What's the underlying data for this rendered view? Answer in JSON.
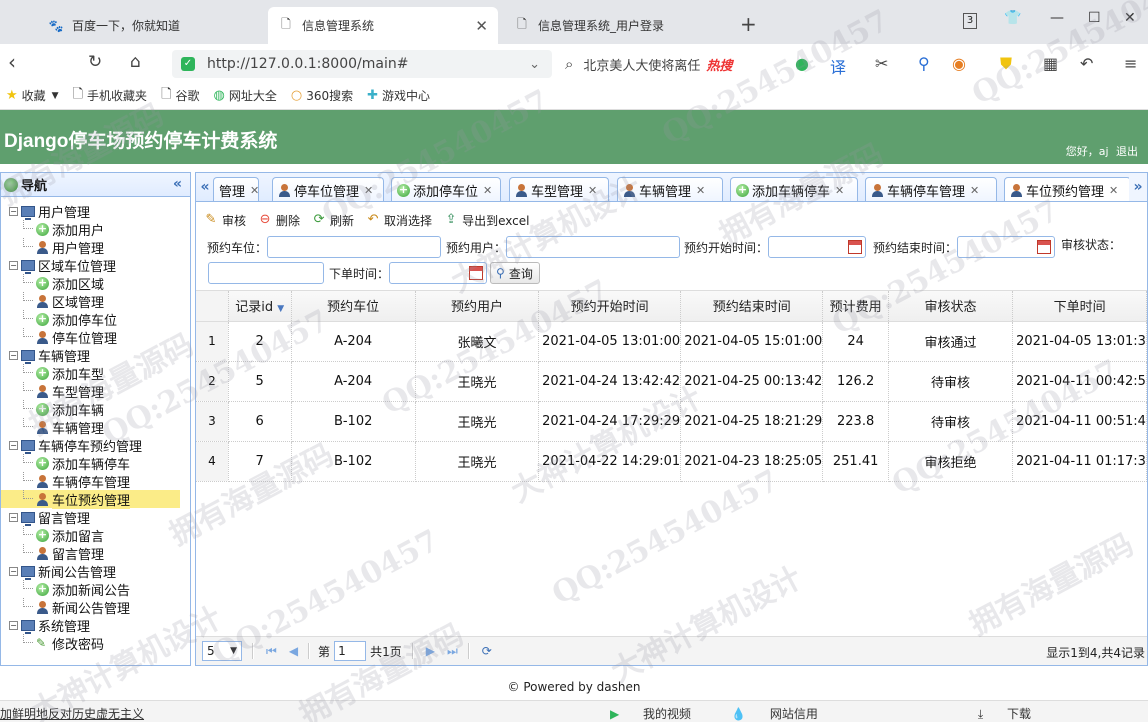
{
  "browser": {
    "tabs": [
      {
        "label": "百度一下，你就知道",
        "icon": "paw-icon"
      },
      {
        "label": "信息管理系统",
        "icon": "page-icon"
      },
      {
        "label": "信息管理系统_用户登录",
        "icon": "page-icon"
      }
    ],
    "tab_count": "3",
    "url": "http://127.0.0.1:8000/main#",
    "search_placeholder": "北京美人大使将离任",
    "search_hot": "热搜",
    "bookmarks": [
      "收藏",
      "手机收藏夹",
      "谷歌",
      "网址大全",
      "360搜索",
      "游戏中心"
    ]
  },
  "app": {
    "title": "Django停车场预约停车计费系统",
    "greeting": "您好，aj",
    "logout": "退出",
    "accent_color": "#5f9f6e"
  },
  "nav": {
    "title": "导航",
    "groups": [
      {
        "label": "用户管理",
        "children": [
          "添加用户",
          "用户管理"
        ]
      },
      {
        "label": "区域车位管理",
        "children": [
          "添加区域",
          "区域管理",
          "添加停车位",
          "停车位管理"
        ]
      },
      {
        "label": "车辆管理",
        "children": [
          "添加车型",
          "车型管理",
          "添加车辆",
          "车辆管理"
        ]
      },
      {
        "label": "车辆停车预约管理",
        "children": [
          "添加车辆停车",
          "车辆停车管理",
          "车位预约管理"
        ]
      },
      {
        "label": "留言管理",
        "children": [
          "添加留言",
          "留言管理"
        ]
      },
      {
        "label": "新闻公告管理",
        "children": [
          "添加新闻公告",
          "新闻公告管理"
        ]
      },
      {
        "label": "系统管理",
        "children": [
          "修改密码"
        ]
      }
    ]
  },
  "tabs": [
    "管理",
    "停车位管理",
    "添加停车位",
    "车型管理",
    "车辆管理",
    "添加车辆停车",
    "车辆停车管理",
    "车位预约管理"
  ],
  "toolbar": {
    "audit": "审核",
    "delete": "删除",
    "refresh": "刷新",
    "unselect": "取消选择",
    "export": "导出到excel"
  },
  "filters": {
    "space": "预约车位：",
    "user": "预约用户：",
    "start": "预约开始时间：",
    "end": "预约结束时间：",
    "status": "审核状态：",
    "order_time": "下单时间：",
    "query": "查询"
  },
  "grid": {
    "columns": [
      "记录id",
      "预约车位",
      "预约用户",
      "预约开始时间",
      "预约结束时间",
      "预计费用",
      "审核状态",
      "下单时间"
    ],
    "rows": [
      {
        "n": "1",
        "id": "2",
        "space": "A-204",
        "user": "张曦文",
        "start": "2021-04-05 13:01:00",
        "end": "2021-04-05 15:01:00",
        "fee": "24",
        "status": "审核通过",
        "ordered": "2021-04-05 13:01:3"
      },
      {
        "n": "2",
        "id": "5",
        "space": "A-204",
        "user": "王晓光",
        "start": "2021-04-24 13:42:42",
        "end": "2021-04-25 00:13:42",
        "fee": "126.2",
        "status": "待审核",
        "ordered": "2021-04-11 00:42:5"
      },
      {
        "n": "3",
        "id": "6",
        "space": "B-102",
        "user": "王晓光",
        "start": "2021-04-24 17:29:29",
        "end": "2021-04-25 18:21:29",
        "fee": "223.8",
        "status": "待审核",
        "ordered": "2021-04-11 00:51:4"
      },
      {
        "n": "4",
        "id": "7",
        "space": "B-102",
        "user": "王晓光",
        "start": "2021-04-22 14:29:01",
        "end": "2021-04-23 18:25:05",
        "fee": "251.41",
        "status": "审核拒绝",
        "ordered": "2021-04-11 01:17:3"
      }
    ]
  },
  "pager": {
    "page_size": "5",
    "page_label": "第",
    "page": "1",
    "total_pages": "共1页",
    "info": "显示1到4,共4记录"
  },
  "footer": "© Powered by dashen",
  "status": {
    "left": "加鲜明地反对历史虚无主义",
    "items": [
      "我的视频",
      "网站信用",
      "下载"
    ]
  },
  "watermarks": [
    "QQ:254540457",
    "拥有海量源码",
    "大神计算机设计"
  ]
}
